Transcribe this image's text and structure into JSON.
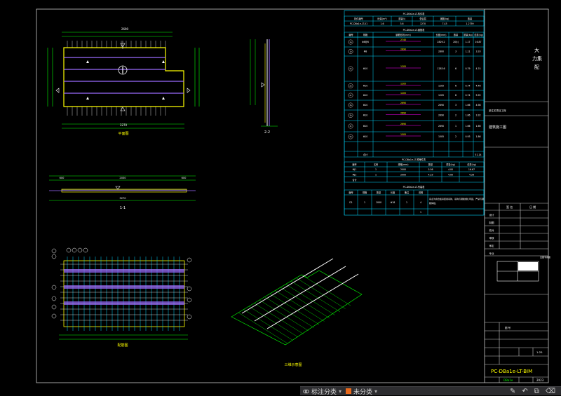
{
  "drawing": {
    "plan_title": "平面图",
    "section_1_title": "1-1",
    "section_2_title": "2-2",
    "bottom_plan_title": "配筋图",
    "iso_title": "三维示意图",
    "dim_top_total": "2690",
    "dim_bottom_total": "3270",
    "dim_section_total": "3270",
    "sec_dims": [
      "600",
      "2030",
      "600"
    ]
  },
  "table_main": {
    "title": "PC-DBa1e-LT-构件表",
    "header": [
      "构件编号",
      "砼量(m³)",
      "重量(t)",
      "叠合层",
      "钢筋(kg)",
      "数量"
    ],
    "row": [
      "PC-DBa1e-LT-01",
      "1.6",
      "3.6",
      "1270",
      "7.43",
      "1.2759"
    ]
  },
  "table_rebar": {
    "title": "PC-DBa1e-LT-钢筋表",
    "header": [
      "编号",
      "规格",
      "钢筋形状(mm)",
      "长度(mm)",
      "数量",
      "重量(kg)",
      "总重(kg)"
    ],
    "rows": [
      {
        "no": "1a",
        "spec": "Φ8@6",
        "shape": "2740",
        "len": "2829.2",
        "qty": "20(t)",
        "w": "1.17",
        "tw": "16.87"
      },
      {
        "no": "1b",
        "spec": "Φ8",
        "shape": "2690",
        "len": "2800",
        "qty": "3",
        "w": "1.11",
        "tw": "3.33"
      },
      {
        "no": "2a",
        "spec": "Φ10",
        "shape": "1205",
        "len": "1283.6",
        "qty": "6",
        "w": "0.79",
        "tw": "4.74"
      },
      {
        "no": "2b",
        "spec": "Φ10",
        "shape": "1205",
        "len": "1205",
        "qty": "6",
        "w": "0.74",
        "tw": "4.46"
      },
      {
        "no": "2c",
        "spec": "Φ10",
        "shape": "1205",
        "len": "1205",
        "qty": "8",
        "w": "0.74",
        "tw": "5.95"
      },
      {
        "no": "3a",
        "spec": "Φ10",
        "shape": "2690",
        "len": "2690",
        "qty": "3",
        "w": "1.66",
        "tw": "4.98"
      },
      {
        "no": "3b",
        "spec": "Φ10",
        "shape": "2690",
        "len": "2690",
        "qty": "2",
        "w": "1.66",
        "tw": "3.32"
      },
      {
        "no": "3c",
        "spec": "Φ10",
        "shape": "2690",
        "len": "2690",
        "qty": "1",
        "w": "1.66",
        "tw": "1.66"
      },
      {
        "no": "4a",
        "spec": "Φ10",
        "shape": "1505",
        "len": "1505",
        "qty": "2",
        "w": "0.93",
        "tw": "1.86"
      }
    ],
    "total_label": "合计",
    "total": "51.14"
  },
  "table_embed": {
    "title": "PC-DBa1e-LT-预埋件表",
    "header": [
      "编号",
      "名称",
      "规格(mm)",
      "数量",
      "重量(kg)",
      "总重(kg)"
    ],
    "rows": [
      [
        "MJ1",
        "1",
        "2000",
        "5.56",
        "4.00",
        "16.67"
      ],
      [
        "MJ2",
        "1",
        "2000",
        "4.23",
        "4.00",
        "4.26"
      ],
      [
        "合计",
        "",
        "",
        "",
        "",
        ""
      ]
    ]
  },
  "table_hoist": {
    "title": "PC-DBa1e-LT-吊装表",
    "header": [
      "编号",
      "规格",
      "数量",
      "长度",
      "备注",
      "说明"
    ],
    "row": [
      "D1",
      "1",
      "1000",
      "Φ18",
      "1",
      "4"
    ],
    "note": "吊点为叠合板吊装用吊钩，吊钩与钢筋绑扎牢固，严禁与钢筋焊接。",
    "row2": [
      "",
      "",
      "",
      "",
      "",
      "1"
    ]
  },
  "title_block": {
    "company": "大\n力集\n配",
    "project_label": "某住宅项目工程",
    "drawing_label": "建筑施工图",
    "sign_rows": [
      "设计",
      "制图",
      "校对",
      "审核",
      "审定",
      "专业"
    ],
    "col_labels": [
      "签 名",
      "日 期"
    ],
    "drawing_no_label": "图 号",
    "scale": "1:25",
    "date_label": "日期",
    "date_value": "2023",
    "version_label": "版次",
    "drawing_name": "PC-DBa1e-LT-BIM",
    "drawing_id": "DBa1e",
    "sheet": "1/1",
    "stamp_text": "出图专用章"
  },
  "statusbar": {
    "item1_label": "标注分类",
    "item2_label": "未分类"
  },
  "colors": {
    "cyan": "#00d8ff",
    "yellow": "#ffff00",
    "purple": "#9b6bff",
    "magenta": "#ff00ff",
    "green": "#00ff00",
    "white": "#ffffff",
    "frame": "#c8c8c8"
  }
}
